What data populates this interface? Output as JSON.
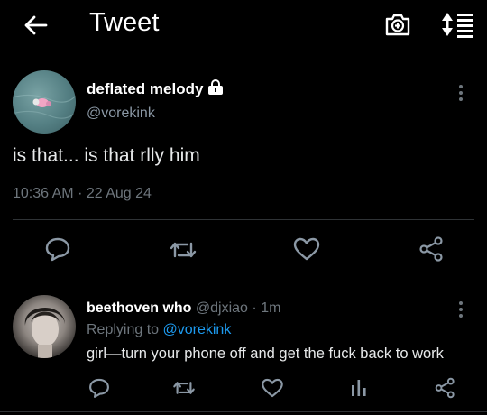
{
  "header": {
    "title": "Tweet",
    "back_icon": "arrow-left-icon",
    "camera_icon": "camera-plus-icon",
    "sort_icon": "sort-icon"
  },
  "main_tweet": {
    "display_name": "deflated melody",
    "handle": "@vorekink",
    "protected_icon": "lock-icon",
    "text": "is that... is that rlly him",
    "timestamp": "10:36 AM",
    "separator": "·",
    "date": "22 Aug 24",
    "actions": [
      "reply-icon",
      "retweet-icon",
      "like-icon",
      "share-icon"
    ]
  },
  "reply_tweet": {
    "display_name": "beethoven who",
    "handle": "@djxiao",
    "separator": "·",
    "time_ago": "1m",
    "replying_prefix": "Replying to",
    "replying_to": "@vorekink",
    "text": "girl—turn your phone off and get the fuck back to work",
    "actions": [
      "reply-icon",
      "retweet-icon",
      "like-icon",
      "analytics-icon",
      "share-icon"
    ]
  },
  "colors": {
    "background": "#000000",
    "text": "#e7e9ea",
    "muted": "#6e767d",
    "link": "#1d9bf0",
    "divider": "#2f3336"
  }
}
